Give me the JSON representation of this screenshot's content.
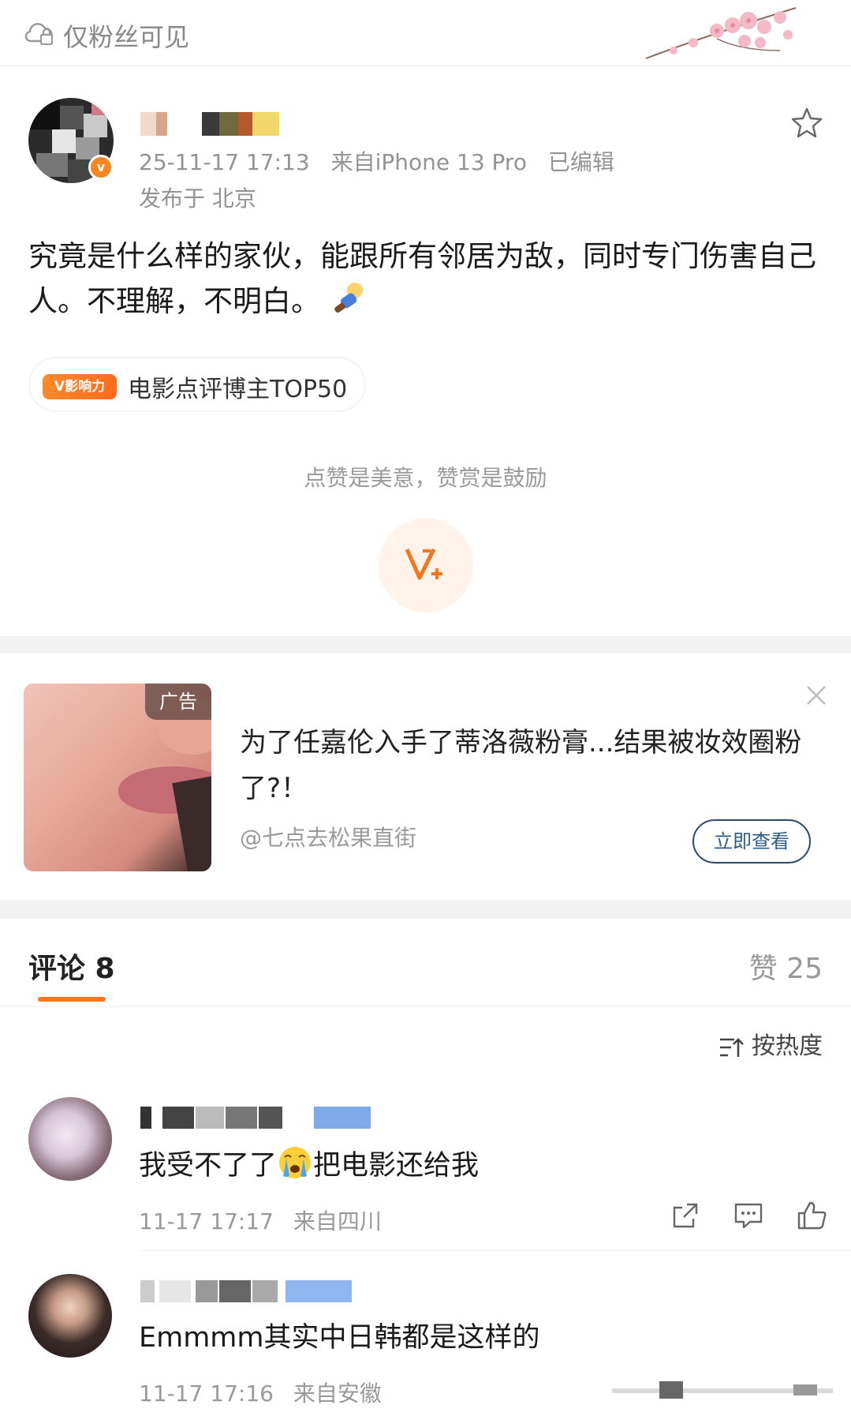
{
  "header": {
    "visibility_label": "仅粉丝可见",
    "visibility_icon": "cloud-lock-icon"
  },
  "post": {
    "timestamp": "25-11-17 17:13",
    "source": "来自iPhone 13 Pro",
    "edited": "已编辑",
    "location": "发布于 北京",
    "text": "究竟是什么样的家伙，能跟所有邻居为敌，同时专门伤害自己人。不理解，不明白。",
    "influence_badge": "V影响力",
    "influence_label": "电影点评博主TOP50",
    "reward_text": "点赞是美意，赞赏是鼓励",
    "accent_color": "#f6761c"
  },
  "ad": {
    "tag": "广告",
    "title": "为了任嘉伦入手了蒂洛薇粉膏...结果被妆效圈粉了?！",
    "source": "@七点去松果直街",
    "cta": "立即查看"
  },
  "comments_section": {
    "comments_tab": "评论 8",
    "likes_tab": "赞 25",
    "sort_label": "按热度"
  },
  "comments": [
    {
      "text_before": "我受不了了",
      "text_after": "把电影还给我",
      "timestamp": "11-17 17:17",
      "location": "来自四川"
    },
    {
      "text_before": "Emmmm其实中日韩都是这样的",
      "text_after": "",
      "timestamp": "11-17 17:16",
      "location": "来自安徽"
    }
  ]
}
